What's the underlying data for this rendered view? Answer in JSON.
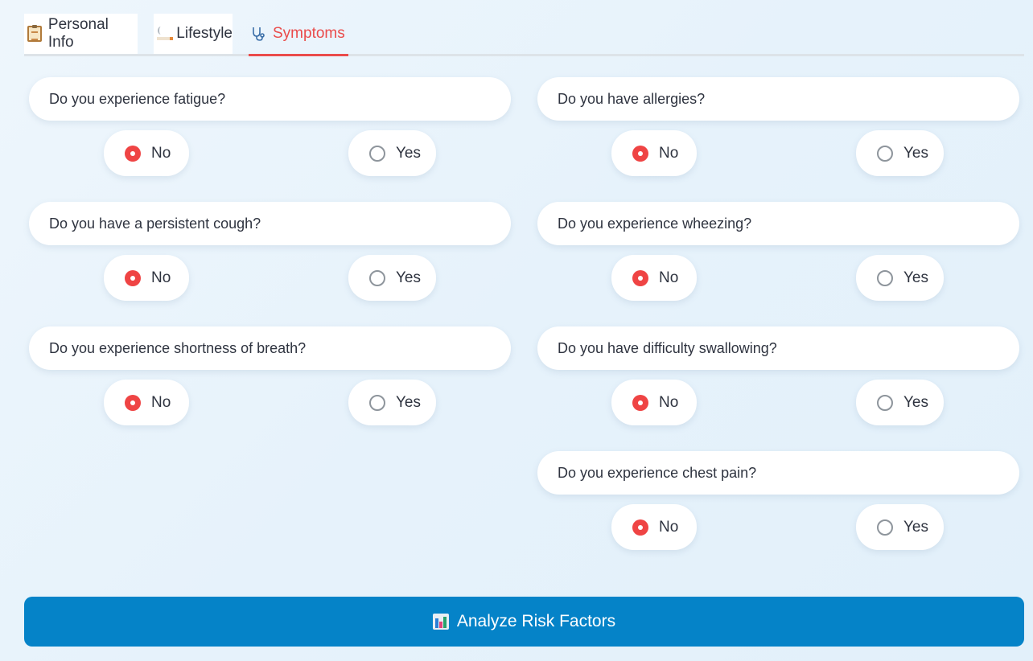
{
  "tabs": [
    {
      "label": "Personal Info",
      "icon": "clipboard-icon"
    },
    {
      "label": "Lifestyle",
      "icon": "cigarette-icon"
    },
    {
      "label": "Symptoms",
      "icon": "stethoscope-icon",
      "active": true
    }
  ],
  "options": {
    "no": "No",
    "yes": "Yes"
  },
  "questions": [
    {
      "text": "Do you experience fatigue?",
      "selected": "No"
    },
    {
      "text": "Do you have allergies?",
      "selected": "No"
    },
    {
      "text": "Do you have a persistent cough?",
      "selected": "No"
    },
    {
      "text": "Do you experience wheezing?",
      "selected": "No"
    },
    {
      "text": "Do you experience shortness of breath?",
      "selected": "No"
    },
    {
      "text": "Do you have difficulty swallowing?",
      "selected": "No"
    },
    {
      "text": "Do you experience chest pain?",
      "selected": "No"
    }
  ],
  "submit": {
    "label": "Analyze Risk Factors",
    "icon": "bar-chart-icon"
  },
  "colors": {
    "accent": "#ea4b4b",
    "button": "#0583c8",
    "radio_checked": "#ef4444"
  }
}
